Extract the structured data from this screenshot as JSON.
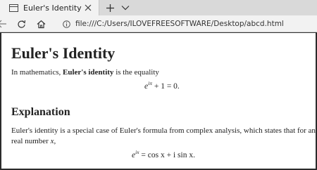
{
  "browser": {
    "tab": {
      "title": "Euler's Identity"
    },
    "new_tab_label": "+",
    "address": "file:///C:/Users/ILOVEFREESOFTWARE/Desktop/abcd.html"
  },
  "page": {
    "heading": "Euler's Identity",
    "intro": {
      "before": "In mathematics, ",
      "bold": "Euler's identity",
      "after": " is the equality"
    },
    "equation1": {
      "base": "e",
      "exponent": "iπ",
      "rest": " + 1 = 0."
    },
    "subheading": "Explanation",
    "explanation_line1": "Euler's identity is a special case of Euler's formula from complex analysis, which states that for any",
    "explanation_line2_text": "real number ",
    "explanation_line2_var": "x",
    "explanation_line2_end": ",",
    "equation2": {
      "base": "e",
      "exponent": "ix",
      "rest": " = cos x + i sin x."
    }
  }
}
